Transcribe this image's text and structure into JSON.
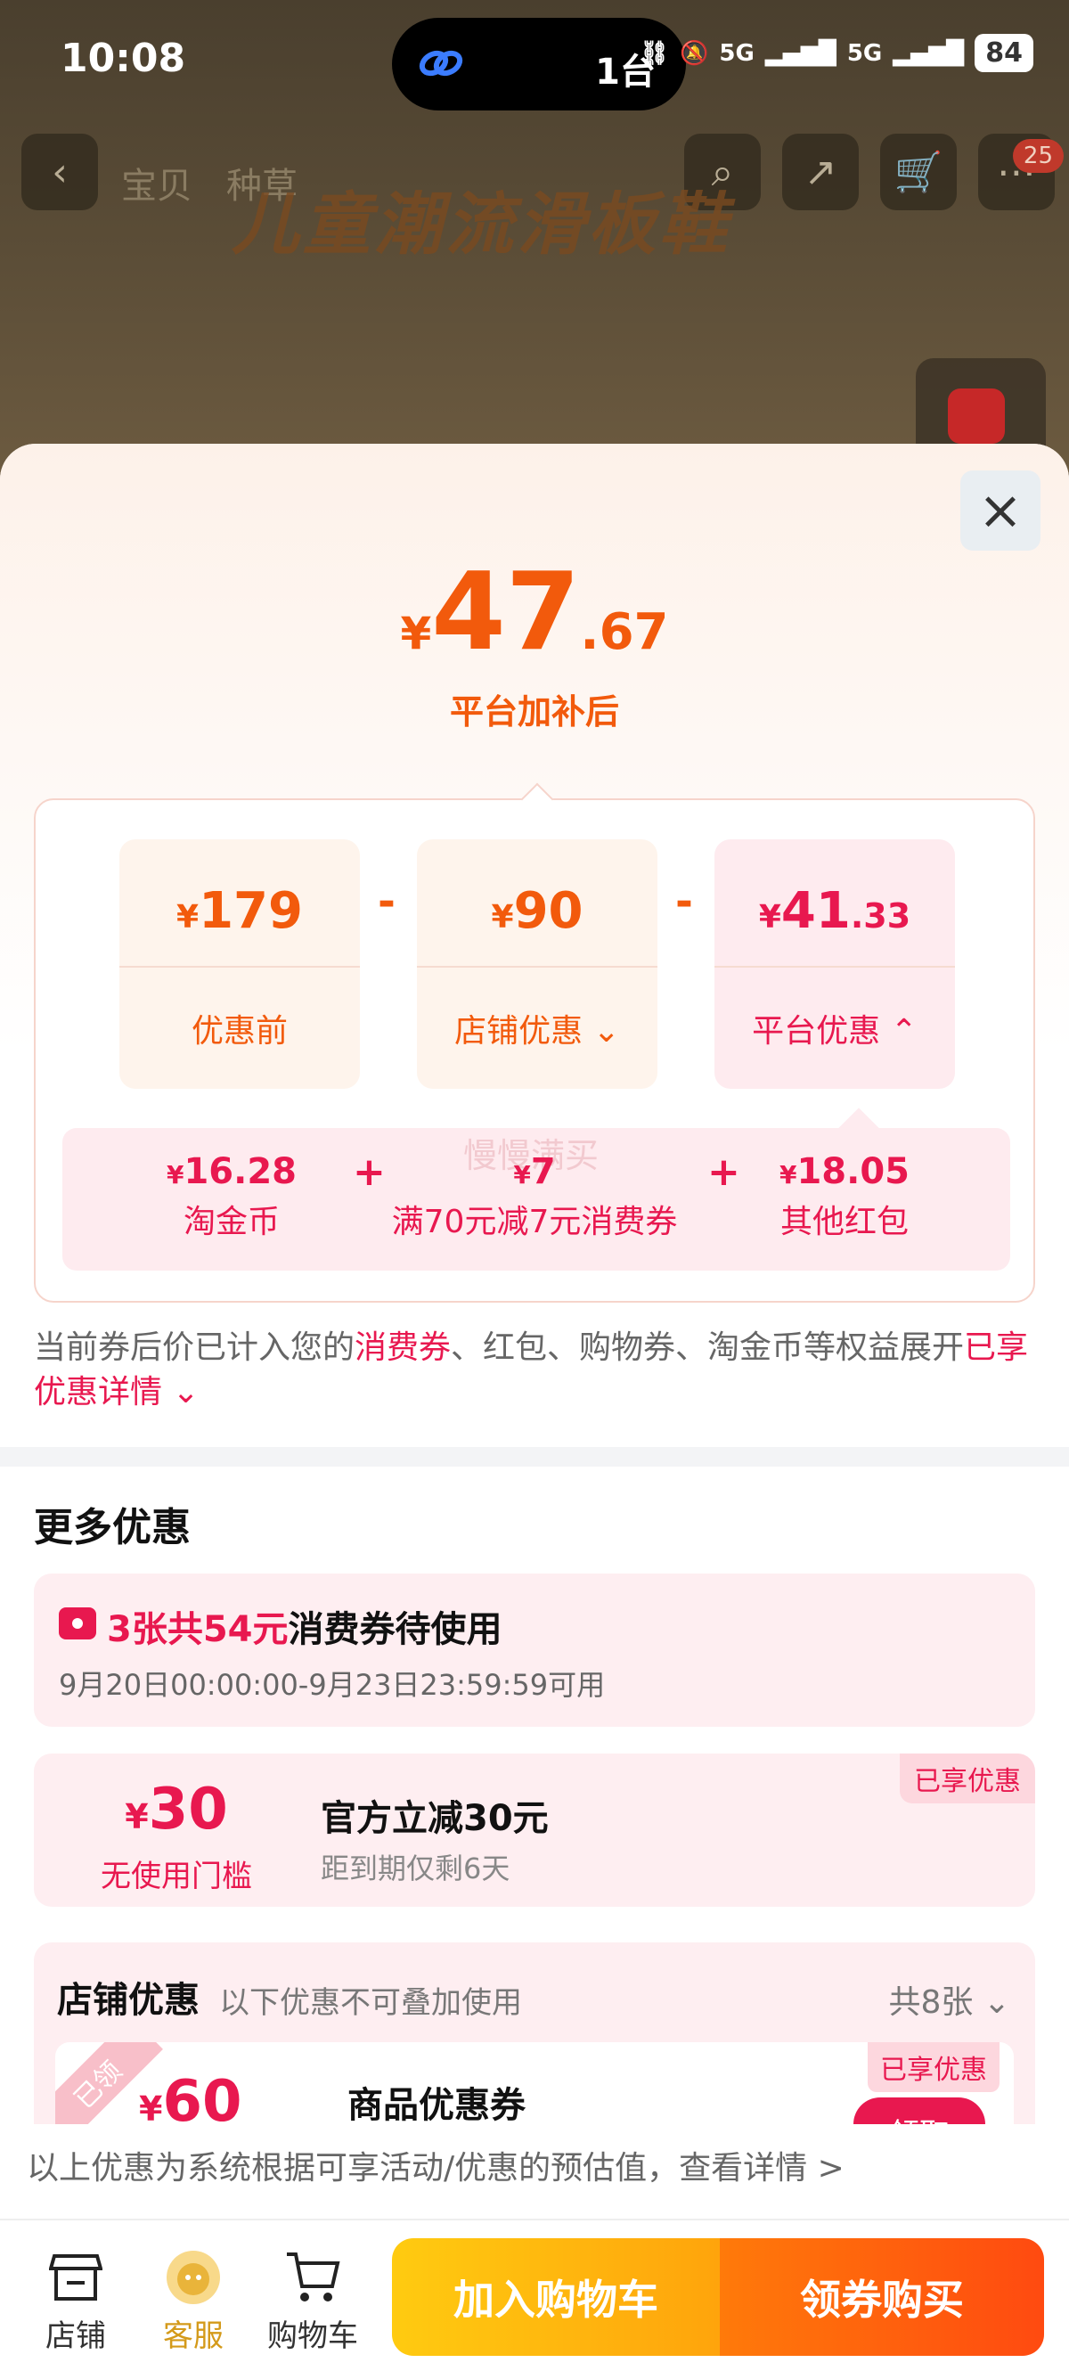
{
  "status_bar": {
    "time": "10:08",
    "island_text": "1台",
    "network_1": "5G",
    "network_2": "5G",
    "battery": "84"
  },
  "product_page": {
    "tabs": [
      "宝贝",
      "种草"
    ],
    "banner_text": "儿童潮流滑板鞋",
    "cart_badge": "25"
  },
  "popup": {
    "close_icon": "close-icon",
    "final_price": {
      "currency": "¥",
      "integer": "47",
      "decimal": ".67"
    },
    "final_price_label": "平台加补后",
    "breakdown": {
      "original": {
        "currency": "¥",
        "value": "179",
        "label": "优惠前"
      },
      "minus_1": "-",
      "store_discount": {
        "currency": "¥",
        "value": "90",
        "label": "店铺优惠"
      },
      "minus_2": "-",
      "platform_discount": {
        "currency": "¥",
        "value": "41",
        "decimal": ".33",
        "label": "平台优惠"
      },
      "sub_items": [
        {
          "currency": "¥",
          "value": "16.28",
          "label": "淘金币"
        },
        {
          "currency": "¥",
          "value": "7",
          "label": "满70元减7元消费券"
        },
        {
          "currency": "¥",
          "value": "18.05",
          "label": "其他红包"
        }
      ],
      "plus": "+",
      "watermark": "慢慢满买"
    },
    "note": {
      "prefix": "当前券后价已计入您的",
      "highlight": "消费券",
      "suffix": "、红包、购物券、淘金币等权益展开",
      "link": "已享优惠详情"
    },
    "more_title": "更多优惠",
    "voucher_summary": {
      "count_text": "3张共54元",
      "text": "消费券待使用",
      "validity": "9月20日00:00:00-9月23日23:59:59可用"
    },
    "official_discount": {
      "tag": "已享优惠",
      "currency": "¥",
      "amount": "30",
      "threshold": "无使用门槛",
      "title": "官方立减30元",
      "expiry": "距到期仅剩6天"
    },
    "store_coupons": {
      "title": "店铺优惠",
      "subtitle": "以下优惠不可叠加使用",
      "count": "共8张",
      "coupon": {
        "ribbon": "已领",
        "tag": "已享优惠",
        "currency": "¥",
        "amount": "60",
        "name": "商品优惠券",
        "button": "领取"
      }
    },
    "footer_note": "以上优惠为系统根据可享活动/优惠的预估值，查看详情 >"
  },
  "bottom_bar": {
    "store": "店铺",
    "customer_service": "客服",
    "cart": "购物车",
    "add_to_cart": "加入购物车",
    "buy_with_coupon": "领券购买"
  },
  "colors": {
    "accent_orange": "#f25a0c",
    "accent_red": "#e8184f",
    "cart_button": "#ffb30e",
    "buy_button": "#ff5a10"
  }
}
